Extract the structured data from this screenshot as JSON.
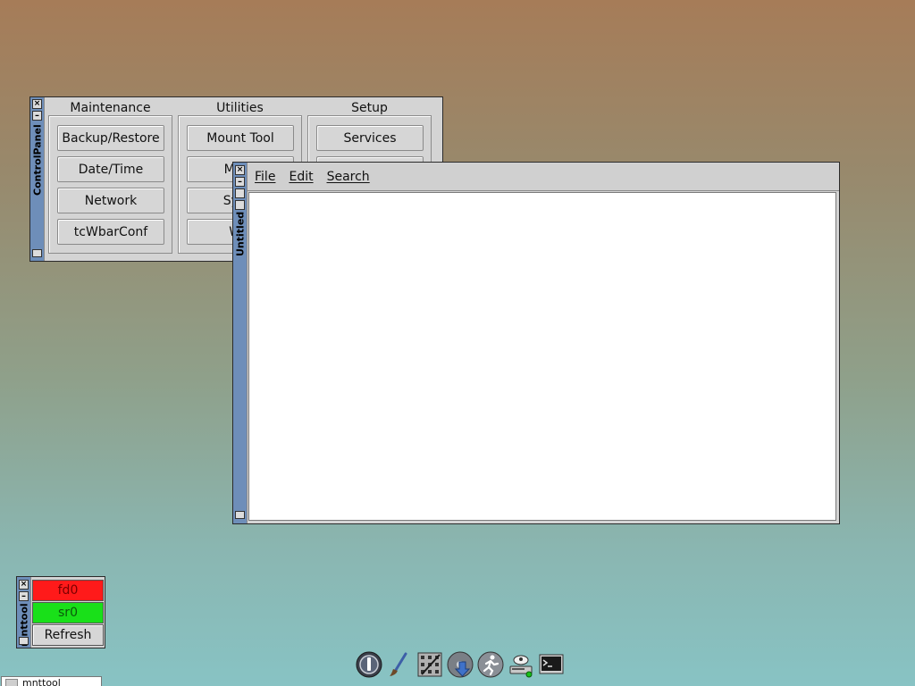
{
  "control_panel": {
    "title": "ControlPanel",
    "columns": [
      {
        "heading": "Maintenance",
        "buttons": [
          "Backup/Restore",
          "Date/Time",
          "Network",
          "tcWbarConf"
        ]
      },
      {
        "heading": "Utilities",
        "buttons": [
          "Mount Tool",
          "Mous",
          "Syste",
          "Wal"
        ]
      },
      {
        "heading": "Setup",
        "buttons": [
          "Services",
          "",
          "",
          ""
        ]
      }
    ]
  },
  "editor": {
    "title": "Untitled",
    "menu": [
      "File",
      "Edit",
      "Search"
    ],
    "content": ""
  },
  "mnttool": {
    "title": "mnttool",
    "drives": [
      {
        "label": "fd0",
        "status": "unmounted",
        "color": "#ff1a1a"
      },
      {
        "label": "sr0",
        "status": "mounted",
        "color": "#19e019"
      }
    ],
    "refresh_label": "Refresh"
  },
  "dock": {
    "icons": [
      "power-icon",
      "paintbrush-icon",
      "apps-grid-icon",
      "install-icon",
      "runner-icon",
      "drive-mount-icon",
      "terminal-icon"
    ]
  },
  "taskbar": {
    "items": [
      "mnttool"
    ]
  },
  "colors": {
    "titlebar": "#6e8eb9",
    "window_bg": "#d4d4d4",
    "unmounted": "#ff1a1a",
    "mounted": "#19e019"
  }
}
